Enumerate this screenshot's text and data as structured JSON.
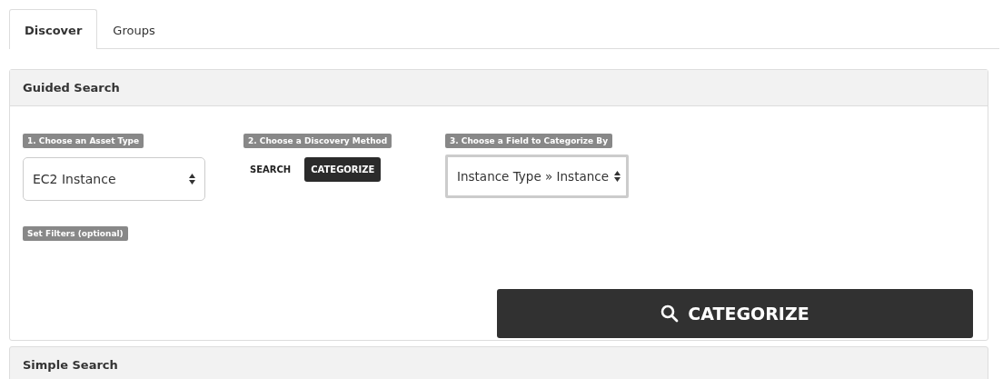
{
  "tabs": [
    {
      "label": "Discover",
      "selected": true
    },
    {
      "label": "Groups",
      "selected": false
    }
  ],
  "guided_search": {
    "title": "Guided Search",
    "asset_type": {
      "label": "1. Choose an Asset Type",
      "value": "EC2 Instance"
    },
    "discovery_method": {
      "label": "2. Choose a Discovery Method",
      "options": [
        {
          "label": "SEARCH",
          "selected": false
        },
        {
          "label": "CATEGORIZE",
          "selected": true
        }
      ]
    },
    "categorize_field": {
      "label": "3. Choose a Field to Categorize By",
      "value": "Instance Type » Instance"
    },
    "filters_label": "Set Filters (optional)",
    "submit_button": "CATEGORIZE"
  },
  "simple_search": {
    "title": "Simple Search"
  }
}
